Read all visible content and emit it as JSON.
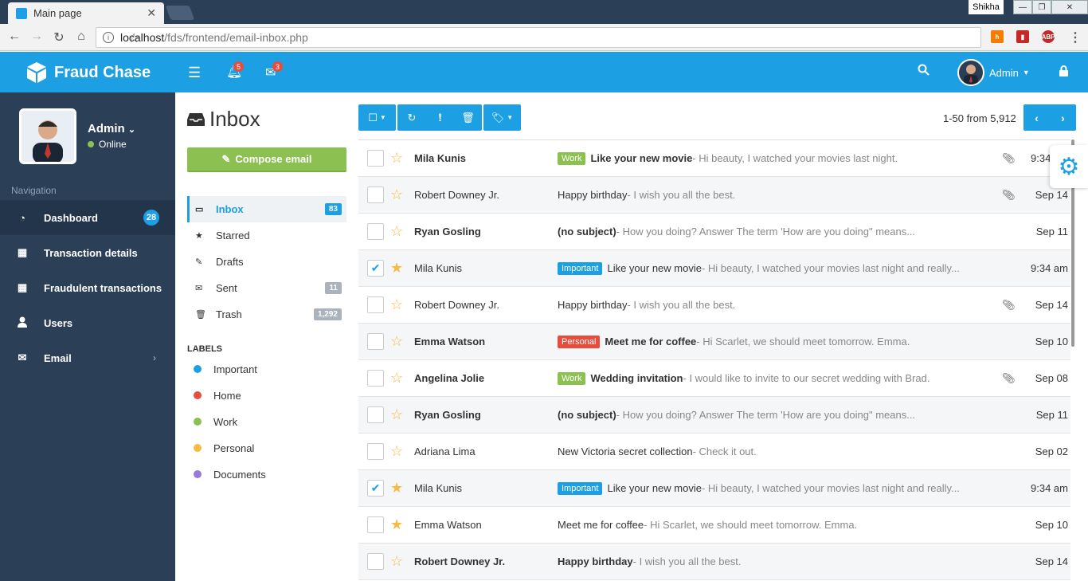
{
  "browser": {
    "tab_title": "Main page",
    "tab_close": "✕",
    "window_user": "Shikha",
    "url_host": "localhost",
    "url_path": "/fds/frontend/email-inbox.php",
    "ext_abp": "ABP"
  },
  "header": {
    "brand": "Fraud Chase",
    "notif_count": "5",
    "mail_count": "3",
    "user": "Admin"
  },
  "sidebar": {
    "profile_name": "Admin",
    "profile_status": "Online",
    "nav_heading": "Navigation",
    "items": [
      {
        "label": "Dashboard",
        "badge": "28"
      },
      {
        "label": "Transaction details"
      },
      {
        "label": "Fraudulent transactions"
      },
      {
        "label": "Users"
      },
      {
        "label": "Email"
      }
    ]
  },
  "mail": {
    "title": "Inbox",
    "compose": "Compose email",
    "folders": [
      {
        "label": "Inbox",
        "count": "83"
      },
      {
        "label": "Starred"
      },
      {
        "label": "Drafts"
      },
      {
        "label": "Sent",
        "count": "11"
      },
      {
        "label": "Trash",
        "count": "1,292"
      }
    ],
    "labels_heading": "LABELS",
    "labels": [
      {
        "label": "Important",
        "color": "#1ca0e3"
      },
      {
        "label": "Home",
        "color": "#e84c3d"
      },
      {
        "label": "Work",
        "color": "#8cc152"
      },
      {
        "label": "Personal",
        "color": "#f6bb42"
      },
      {
        "label": "Documents",
        "color": "#967adc"
      }
    ],
    "pager_text": "1-50 from 5,912",
    "messages": [
      {
        "sender": "Mila Kunis",
        "bold": true,
        "checked": false,
        "starred": false,
        "tag": "Work",
        "tag_color": "#8cc152",
        "subject": "Like your new movie",
        "preview": " - Hi beauty, I watched your movies last night.",
        "clip": true,
        "date": "9:34 am"
      },
      {
        "sender": "Robert Downey Jr.",
        "bold": false,
        "checked": false,
        "starred": false,
        "tag": "",
        "subject": "Happy birthday",
        "preview": " - I wish you all the best.",
        "clip": true,
        "date": "Sep 14"
      },
      {
        "sender": "Ryan Gosling",
        "bold": true,
        "checked": false,
        "starred": false,
        "tag": "",
        "subject": "(no subject)",
        "preview": " - How you doing? Answer The term 'How are you doing\" means...",
        "clip": false,
        "date": "Sep 11"
      },
      {
        "sender": "Mila Kunis",
        "bold": false,
        "checked": true,
        "starred": true,
        "tag": "Important",
        "tag_color": "#1ca0e3",
        "subject": "Like your new movie",
        "preview": " - Hi beauty, I watched your movies last night and really...",
        "clip": false,
        "date": "9:34 am"
      },
      {
        "sender": "Robert Downey Jr.",
        "bold": false,
        "checked": false,
        "starred": false,
        "tag": "",
        "subject": "Happy birthday",
        "preview": " - I wish you all the best.",
        "clip": true,
        "date": "Sep 14"
      },
      {
        "sender": "Emma Watson",
        "bold": true,
        "checked": false,
        "starred": false,
        "tag": "Personal",
        "tag_color": "#e84c3d",
        "subject": "Meet me for coffee",
        "preview": " - Hi Scarlet, we should meet tomorrow. Emma.",
        "clip": false,
        "date": "Sep 10"
      },
      {
        "sender": "Angelina Jolie",
        "bold": true,
        "checked": false,
        "starred": false,
        "tag": "Work",
        "tag_color": "#8cc152",
        "subject": "Wedding invitation",
        "preview": " - I would like to invite to our secret wedding with Brad.",
        "clip": true,
        "date": "Sep 08"
      },
      {
        "sender": "Ryan Gosling",
        "bold": true,
        "checked": false,
        "starred": false,
        "tag": "",
        "subject": "(no subject)",
        "preview": " - How you doing? Answer The term 'How are you doing\" means...",
        "clip": false,
        "date": "Sep 11"
      },
      {
        "sender": "Adriana Lima",
        "bold": false,
        "checked": false,
        "starred": false,
        "tag": "",
        "subject": "New Victoria secret collection",
        "preview": " - Check it out.",
        "clip": false,
        "date": "Sep 02"
      },
      {
        "sender": "Mila Kunis",
        "bold": false,
        "checked": true,
        "starred": true,
        "tag": "Important",
        "tag_color": "#1ca0e3",
        "subject": "Like your new movie",
        "preview": " - Hi beauty, I watched your movies last night and really...",
        "clip": false,
        "date": "9:34 am"
      },
      {
        "sender": "Emma Watson",
        "bold": false,
        "checked": false,
        "starred": true,
        "tag": "",
        "subject": "Meet me for coffee",
        "preview": " - Hi Scarlet, we should meet tomorrow. Emma.",
        "clip": false,
        "date": "Sep 10"
      },
      {
        "sender": "Robert Downey Jr.",
        "bold": true,
        "checked": false,
        "starred": false,
        "tag": "",
        "subject": "Happy birthday",
        "preview": " - I wish you all the best.",
        "clip": false,
        "date": "Sep 14"
      }
    ]
  }
}
